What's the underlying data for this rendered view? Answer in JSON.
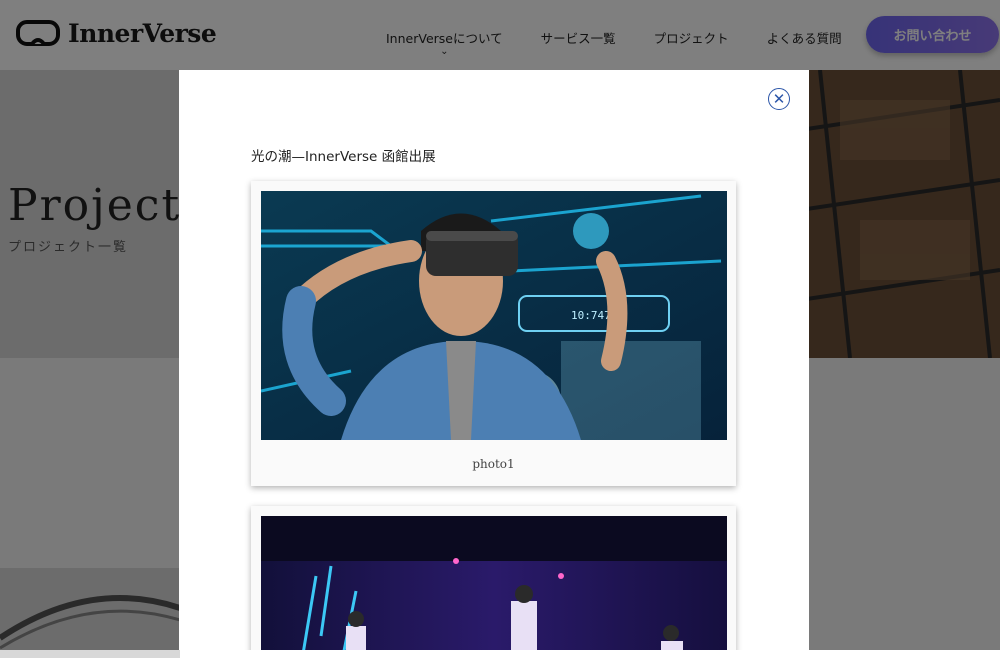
{
  "brand": {
    "name": "InnerVerse"
  },
  "nav": {
    "items": [
      {
        "label": "InnerVerseについて",
        "has_dropdown": true
      },
      {
        "label": "サービス一覧"
      },
      {
        "label": "プロジェクト"
      },
      {
        "label": "よくある質問"
      }
    ],
    "cta_label": "お問い合わせ"
  },
  "hero": {
    "title": "Project",
    "subtitle": "プロジェクト一覧"
  },
  "modal": {
    "title": "光の潮—InnerVerse 函館出展",
    "photos": [
      {
        "caption": "photo1"
      },
      {
        "caption": ""
      }
    ]
  },
  "colors": {
    "accent_start": "#6e66f0",
    "accent_end": "#8f74ee",
    "close_icon": "#2b55a8"
  }
}
